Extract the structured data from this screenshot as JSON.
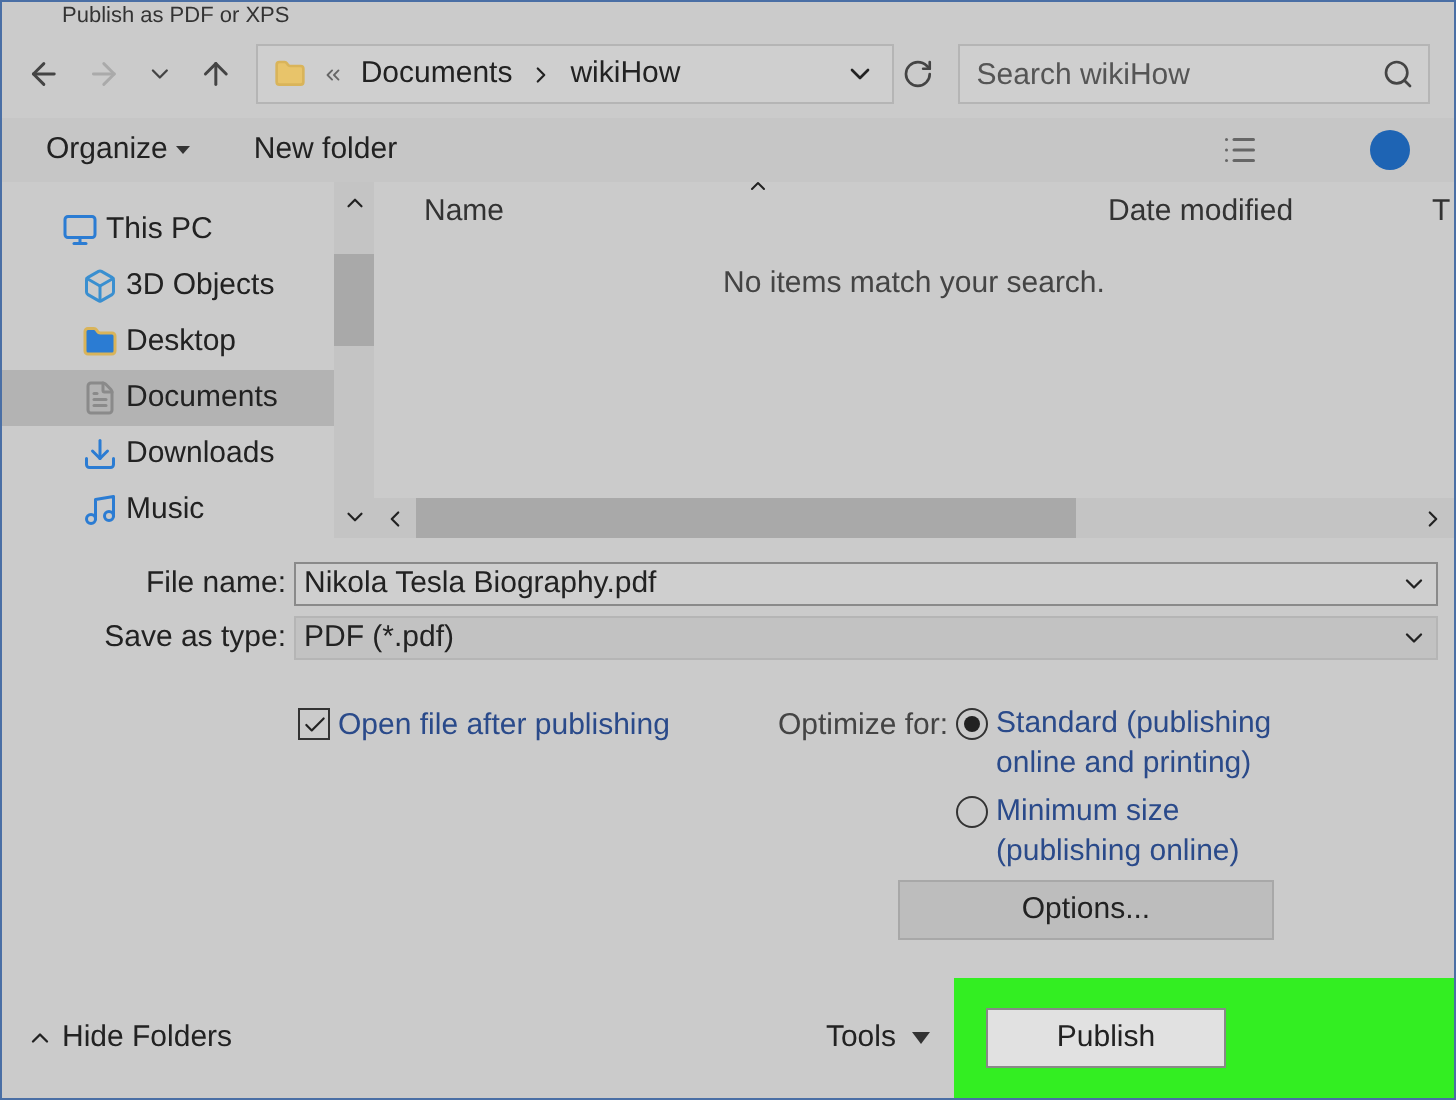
{
  "window": {
    "title": "Publish as PDF or XPS"
  },
  "address_bar": {
    "path": [
      {
        "label": "Documents"
      },
      {
        "label": "wikiHow"
      }
    ]
  },
  "search": {
    "placeholder": "Search wikiHow"
  },
  "toolbar": {
    "organize": "Organize",
    "new_folder": "New folder"
  },
  "sidebar": {
    "items": [
      {
        "label": "This PC",
        "kind": "pc",
        "selected": false,
        "children": [
          {
            "label": "3D Objects",
            "kind": "objects",
            "selected": false
          },
          {
            "label": "Desktop",
            "kind": "desktop",
            "selected": false
          },
          {
            "label": "Documents",
            "kind": "documents",
            "selected": true
          },
          {
            "label": "Downloads",
            "kind": "downloads",
            "selected": false
          },
          {
            "label": "Music",
            "kind": "music",
            "selected": false
          }
        ]
      }
    ]
  },
  "file_list": {
    "columns": [
      "Name",
      "Date modified",
      "T"
    ],
    "empty_message": "No items match your search."
  },
  "form": {
    "file_name": {
      "label": "File name:",
      "value": "Nikola Tesla Biography.pdf"
    },
    "save_as_type": {
      "label": "Save as type:",
      "value": "PDF (*.pdf)"
    }
  },
  "open_after": {
    "label": "Open file after publishing",
    "checked": true
  },
  "optimize": {
    "label": "Optimize for:",
    "options": [
      {
        "label": "Standard (publishing online and printing)",
        "selected": true
      },
      {
        "label": "Minimum size (publishing online)",
        "selected": false
      }
    ]
  },
  "options_button": "Options...",
  "footer": {
    "hide_folders": "Hide Folders",
    "tools": "Tools",
    "publish": "Publish",
    "publish_highlighted": true
  }
}
